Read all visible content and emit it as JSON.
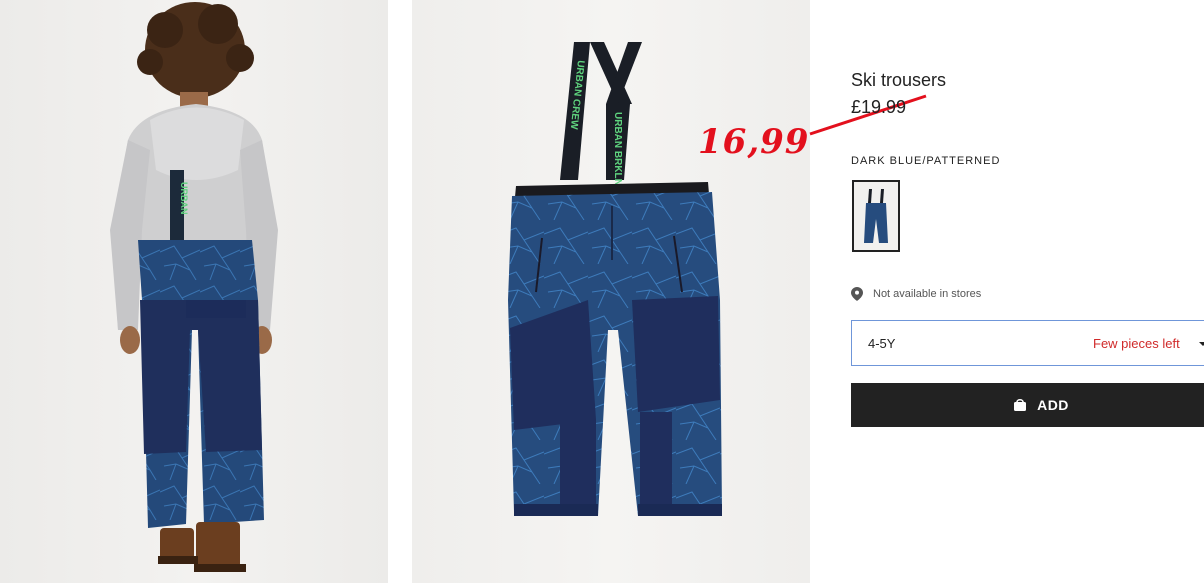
{
  "product": {
    "title": "Ski trousers",
    "old_price": "£19.99",
    "sale_price": "16,99",
    "color_label": "DARK BLUE/PATTERNED",
    "availability": "Not available in stores",
    "size": "4-5Y",
    "stock": "Few pieces left",
    "add_label": "ADD"
  },
  "model_photo": {
    "strap_text": "URBAN"
  },
  "product_photo": {
    "strap_left": "URBAN CREW",
    "strap_right": "URBAN BRKLN"
  },
  "icons": {
    "location": "map-pin-icon",
    "bag": "shopping-bag-icon",
    "dropdown": "chevron-down-icon"
  },
  "colors": {
    "sale": "#e3101d",
    "stock": "#d02a2a",
    "button": "#222222",
    "trouser": "#244a7a",
    "strap_text": "#5fd37e"
  }
}
